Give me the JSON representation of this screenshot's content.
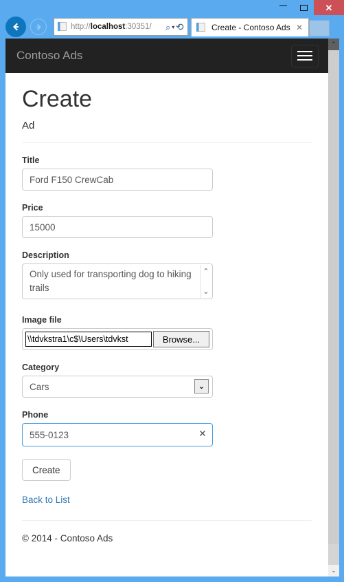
{
  "window": {
    "controls": {
      "minimize": "minimize-button",
      "maximize": "maximize-button",
      "close": "✕"
    }
  },
  "browser": {
    "back_label": "Back",
    "forward_label": "Forward",
    "address": {
      "url_scheme": "http://",
      "url_host": "localhost",
      "url_rest": ":30351/",
      "search_icon": "⌕",
      "dropdown_icon": "▾",
      "refresh_icon": "⟳"
    },
    "tab": {
      "title": "Create - Contoso Ads",
      "close_label": "✕"
    },
    "newtab_label": ""
  },
  "site": {
    "brand": "Contoso Ads",
    "menu_toggle": "navbar-toggle"
  },
  "page": {
    "title": "Create",
    "subtitle": "Ad"
  },
  "form": {
    "fields": {
      "title": {
        "label": "Title",
        "value": "Ford F150 CrewCab"
      },
      "price": {
        "label": "Price",
        "value": "15000"
      },
      "description": {
        "label": "Description",
        "value": "Only used for transporting dog to hiking trails",
        "scroll_up_icon": "⌃",
        "scroll_down_icon": "⌄"
      },
      "image_file": {
        "label": "Image file",
        "path_value": "\\\\tdvkstra1\\c$\\Users\\tdvkst",
        "browse_label": "Browse..."
      },
      "category": {
        "label": "Category",
        "selected": "Cars",
        "options": [
          "Cars"
        ],
        "arrow_icon": "⌄"
      },
      "phone": {
        "label": "Phone",
        "value": "555-0123",
        "clear_icon": "✕"
      }
    },
    "submit_label": "Create",
    "back_link": "Back to List"
  },
  "footer": {
    "text": "© 2014 - Contoso Ads"
  },
  "scrollbar": {
    "up_icon": "⌃",
    "down_icon": "⌄"
  }
}
